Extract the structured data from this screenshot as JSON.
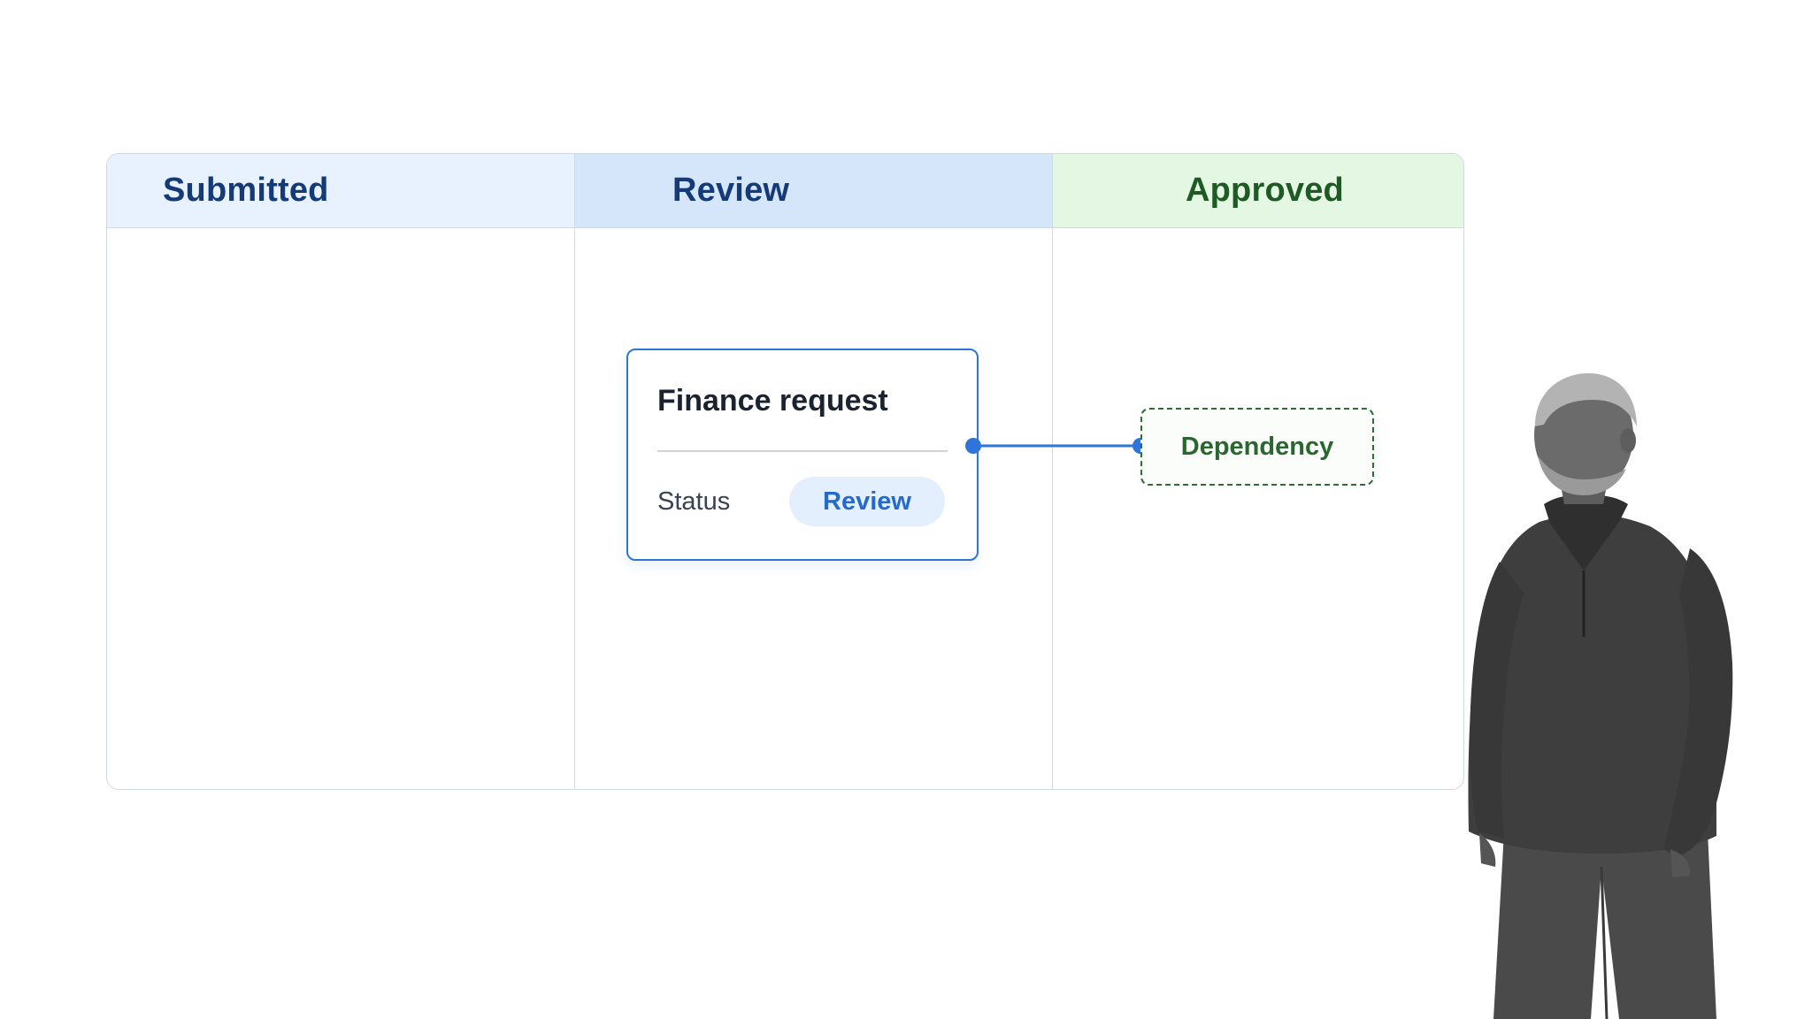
{
  "board": {
    "columns": [
      {
        "title": "Submitted"
      },
      {
        "title": "Review"
      },
      {
        "title": "Approved"
      }
    ]
  },
  "card": {
    "title": "Finance request",
    "status_label": "Status",
    "status_value": "Review"
  },
  "dependency": {
    "label": "Dependency"
  },
  "colors": {
    "accent_blue": "#2f74d8",
    "submitted_header": "#e8f2fe",
    "review_header": "#d5e6fb",
    "approved_header": "#e3f7e3",
    "approved_text": "#1f5a24",
    "dependency_border": "#2f6b35"
  },
  "icons": [
    "connector-dot-icon",
    "person-photo"
  ]
}
